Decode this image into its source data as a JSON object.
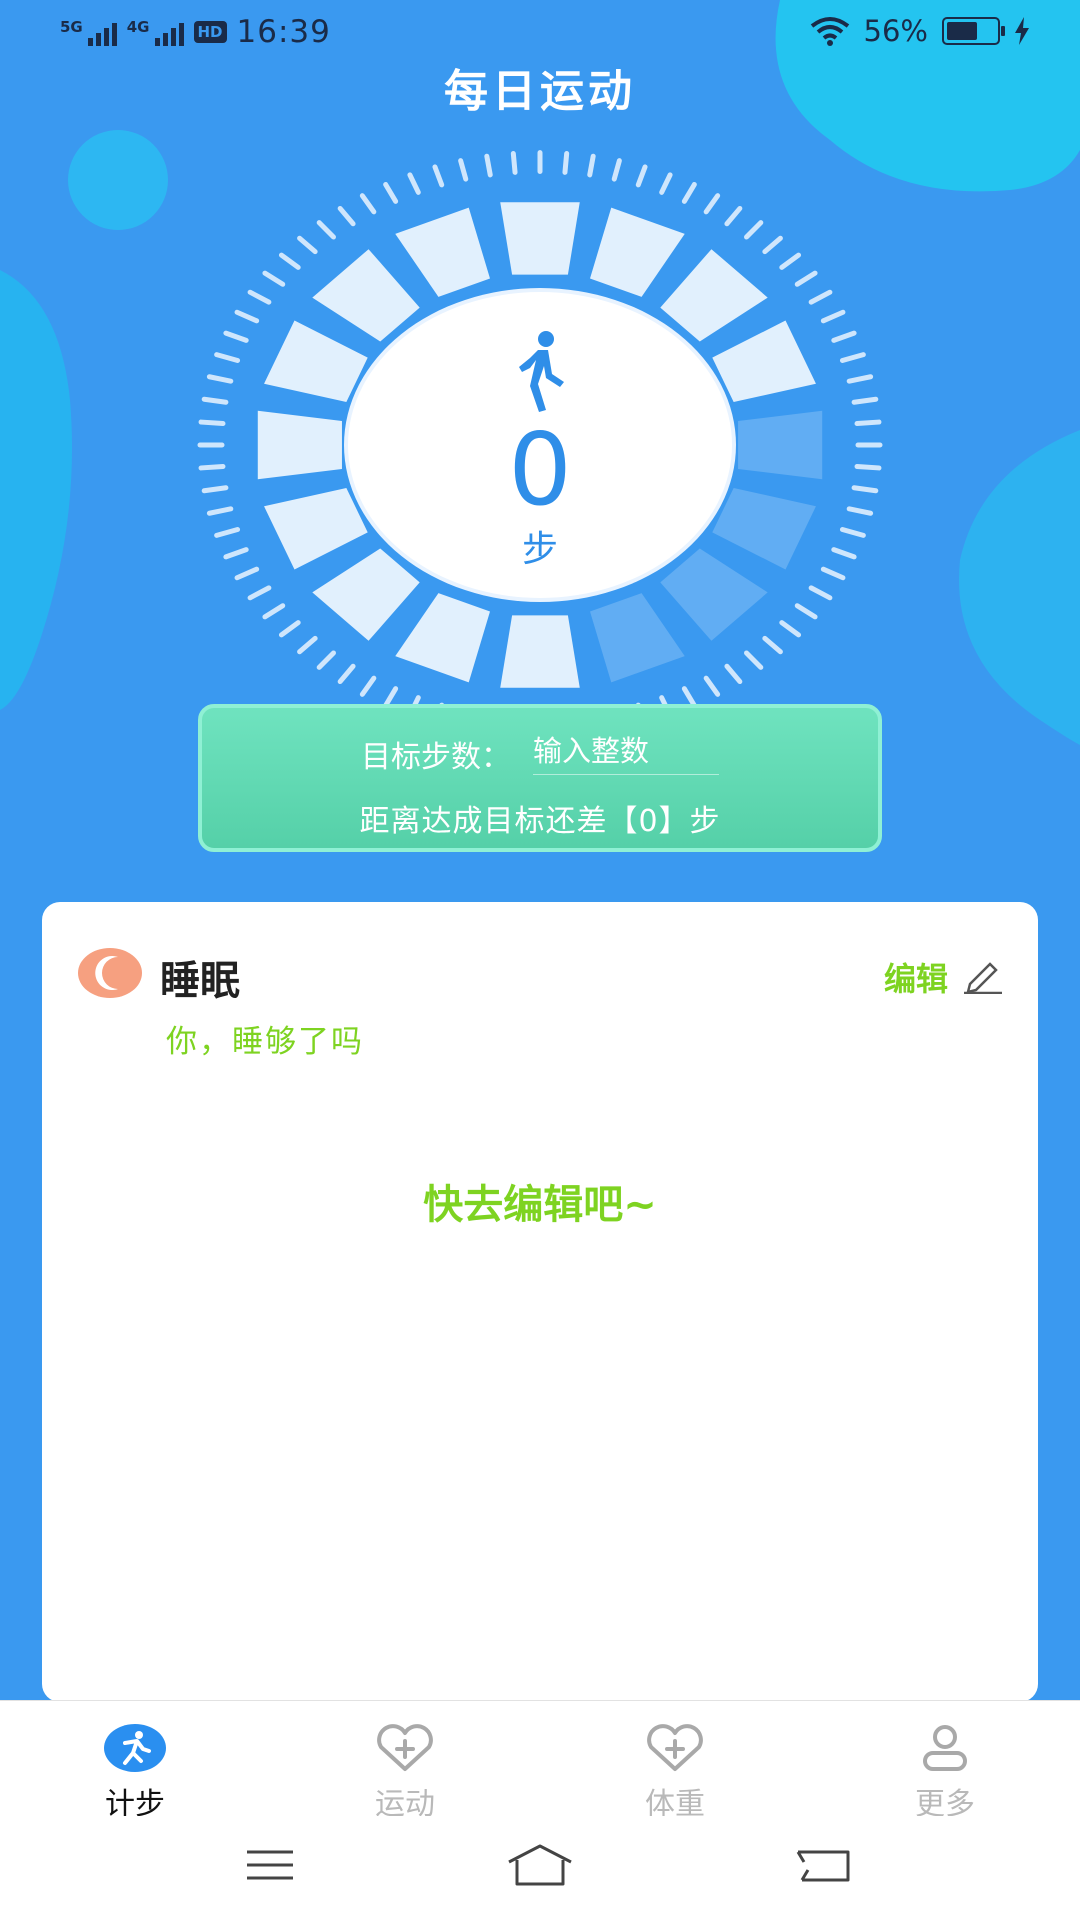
{
  "status_bar": {
    "sim1_label": "5G",
    "sim2_label": "4G",
    "hd_badge": "HD",
    "time": "16:39",
    "battery_text": "56%",
    "battery_level": 0.56,
    "charging": true
  },
  "app": {
    "title": "每日运动"
  },
  "pedometer": {
    "steps": "0",
    "unit": "步",
    "accent_color": "#2f8ee8"
  },
  "goal": {
    "label": "目标步数：",
    "input_placeholder": "输入整数",
    "input_value": "",
    "remaining_text": "距离达成目标还差【0】步"
  },
  "sleep_card": {
    "title": "睡眠",
    "edit_label": "编辑",
    "subtitle": "你，睡够了吗",
    "empty_prompt": "快去编辑吧~",
    "accent_color": "#7ed321",
    "icon": "moon-icon"
  },
  "bottom_nav": {
    "items": [
      {
        "label": "计步",
        "icon": "runner-icon",
        "active": true
      },
      {
        "label": "运动",
        "icon": "heart-plus-icon",
        "active": false
      },
      {
        "label": "体重",
        "icon": "heart-plus-icon",
        "active": false
      },
      {
        "label": "更多",
        "icon": "user-icon",
        "active": false
      }
    ]
  },
  "system_nav": {
    "icons": [
      "menu-icon",
      "home-icon",
      "back-icon"
    ]
  }
}
